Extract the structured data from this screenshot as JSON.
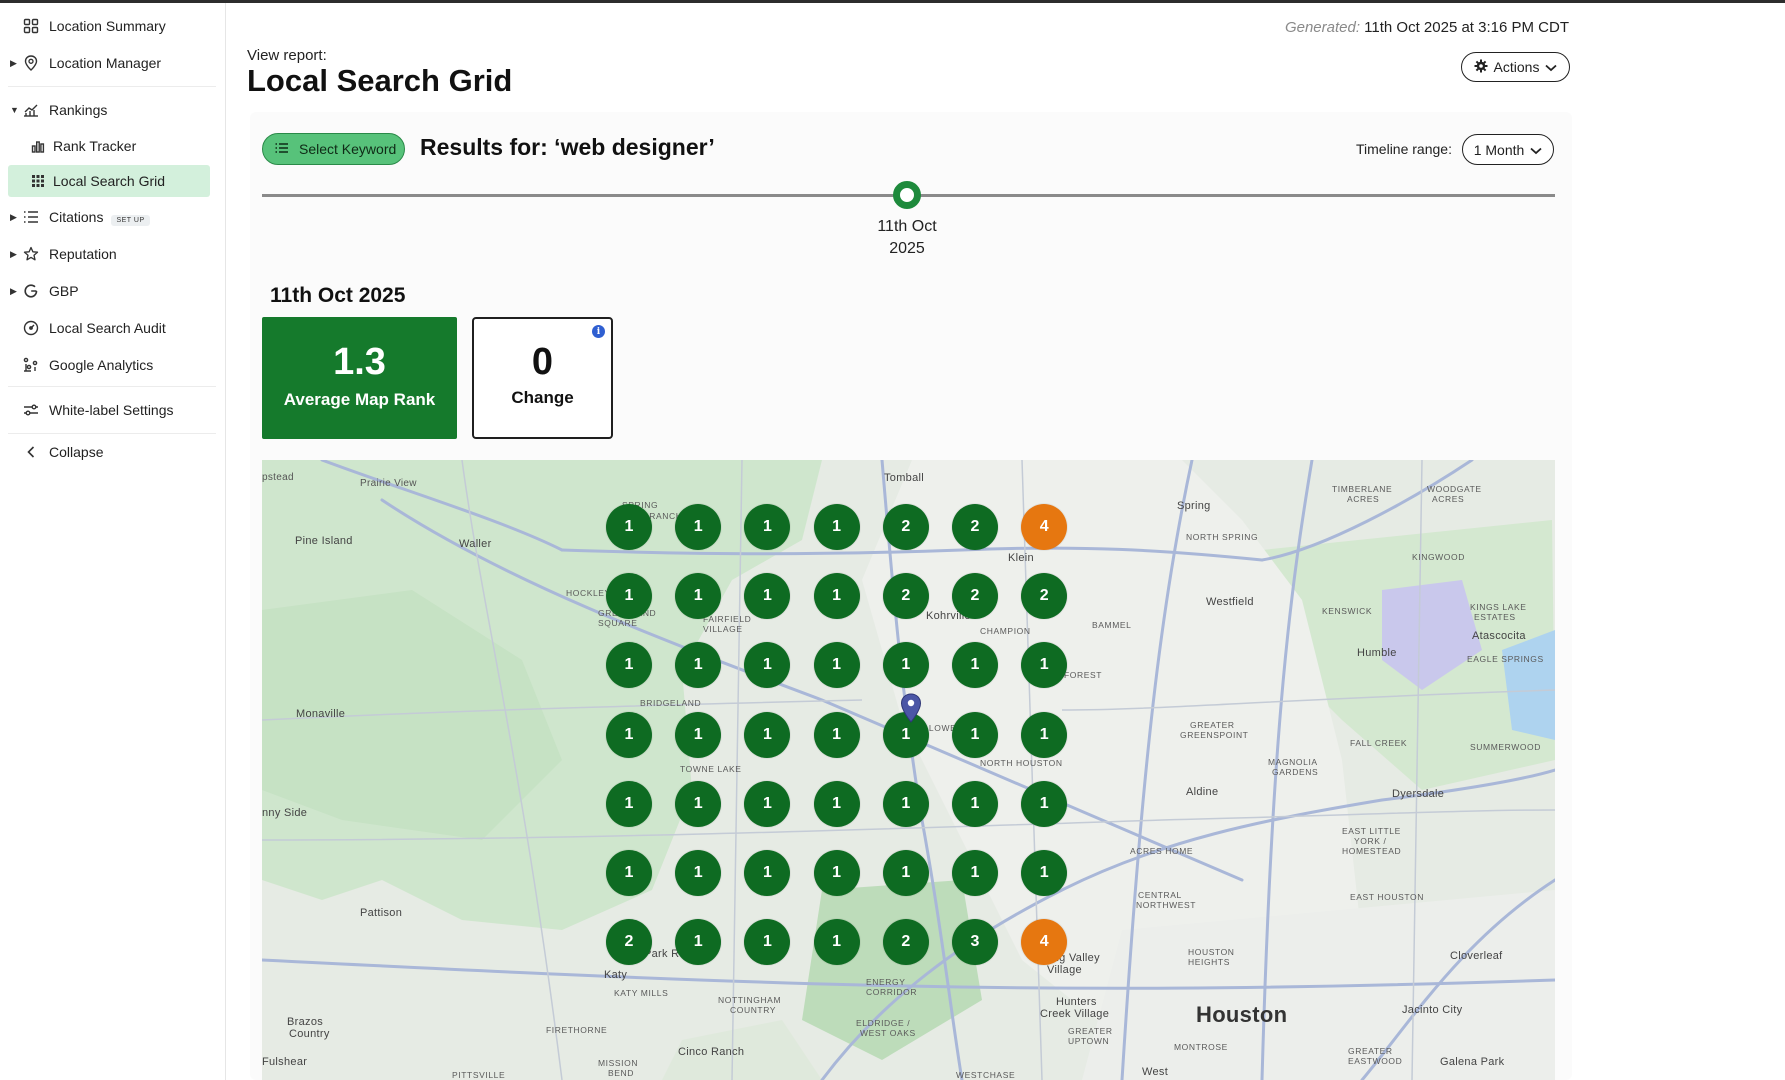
{
  "header": {
    "generated_label": "Generated:",
    "generated_value": "11th Oct 2025 at 3:16 PM CDT",
    "view_report": "View report:",
    "title": "Local Search Grid",
    "actions_label": "Actions"
  },
  "sidebar": {
    "location_summary": "Location Summary",
    "location_manager": "Location Manager",
    "rankings": "Rankings",
    "rank_tracker": "Rank Tracker",
    "local_search_grid": "Local Search Grid",
    "citations": "Citations",
    "citations_badge": "SET UP",
    "reputation": "Reputation",
    "gbp": "GBP",
    "local_search_audit": "Local Search Audit",
    "google_analytics": "Google Analytics",
    "white_label": "White-label Settings",
    "collapse": "Collapse"
  },
  "toolbar": {
    "select_keyword": "Select Keyword",
    "results_for": "Results for: ‘web designer’",
    "timeline_label": "Timeline range:",
    "timeline_value": "1 Month"
  },
  "timeline": {
    "point_line1": "11th Oct",
    "point_line2": "2025"
  },
  "summary": {
    "date": "11th Oct 2025",
    "average_value": "1.3",
    "average_label": "Average Map Rank",
    "change_value": "0",
    "change_label": "Change"
  },
  "map": {
    "city": "Houston",
    "grid_ranks": [
      [
        1,
        1,
        1,
        1,
        2,
        2,
        4
      ],
      [
        1,
        1,
        1,
        1,
        2,
        2,
        2
      ],
      [
        1,
        1,
        1,
        1,
        1,
        1,
        1
      ],
      [
        1,
        1,
        1,
        1,
        1,
        1,
        1
      ],
      [
        1,
        1,
        1,
        1,
        1,
        1,
        1
      ],
      [
        1,
        1,
        1,
        1,
        1,
        1,
        1
      ],
      [
        2,
        1,
        1,
        1,
        2,
        3,
        4
      ]
    ],
    "rank_colors": {
      "top3": "#0e6b22",
      "mid": "#e67710"
    },
    "labels": [
      "pstead",
      "Prairie View",
      "Tomball",
      "SPRING",
      "CREEK RANCH",
      "Spring",
      "TIMBERLANE",
      "ACRES",
      "WOODGATE",
      "ACRES",
      "NORTH SPRING",
      "Pine Island",
      "Waller",
      "Klein",
      "KINGWOOD",
      "HOCKLEY",
      "GREENLAND",
      "SQUARE",
      "FAIRFIELD",
      "VILLAGE",
      "Kohrville",
      "CHAMPION",
      "FOREST",
      "BAMMEL",
      "Westfield",
      "KENSWICK",
      "Humble",
      "KINGS LAKE",
      "ESTATES",
      "Atascocita",
      "EAGLE SPRINGS",
      "Monaville",
      "BRIDGELAND",
      "WILLOWBROOK",
      "GREATER",
      "GREENSPOINT",
      "FALL CREEK",
      "SUMMERWOOD",
      "TOWNE LAKE",
      "NORTH HOUSTON",
      "MAGNOLIA",
      "GARDENS",
      "Aldine",
      "Dyersdale",
      "nny Side",
      "EAST LITTLE",
      "YORK /",
      "HOMESTEAD",
      "ACRES HOME",
      "CENTRAL",
      "NORTHWEST",
      "EAST HOUSTON",
      "Pattison",
      "HOUSTON",
      "HEIGHTS",
      "Cloverleaf",
      "Park Row",
      "Spring Valley",
      "Village",
      "Katy",
      "KATY MILLS",
      "ENERGY",
      "CORRIDOR",
      "NOTTINGHAM",
      "COUNTRY",
      "Hunters",
      "Creek Village",
      "Houston",
      "Jacinto City",
      "Brazos",
      "Country",
      "FIRETHORNE",
      "ELDRIDGE /",
      "WEST OAKS",
      "GREATER",
      "UPTOWN",
      "MONTROSE",
      "GREATER",
      "EASTWOOD",
      "Galena Park",
      "Fulshear",
      "Cinco Ranch",
      "MISSION",
      "BEND",
      "PITTSVILLE",
      "WESTCHASE",
      "West"
    ]
  }
}
